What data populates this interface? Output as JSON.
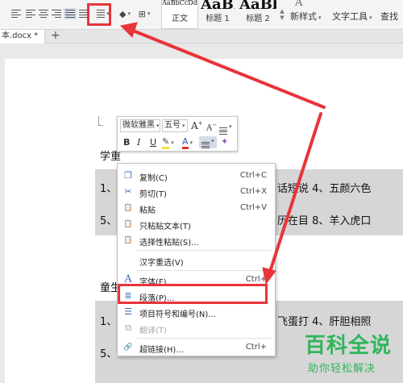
{
  "ribbon": {
    "styles": [
      {
        "preview": "AaBbCcDd",
        "label": "正文"
      },
      {
        "preview": "AaBl",
        "label": "标题 1"
      },
      {
        "preview": "AaBb",
        "label": "标题 2"
      }
    ],
    "new_style_label": "新样式",
    "new_style_icon_letter": "A",
    "text_tools_label": "文字工具",
    "find_label": "查找"
  },
  "tabs": {
    "doc_tab_label": "本.docx *",
    "add_tab": "+"
  },
  "mini_toolbar": {
    "font_name": "微软雅黑",
    "font_size": "五号",
    "grow": "A",
    "shrink": "A",
    "bold": "B",
    "italic": "I",
    "underline": "U",
    "font_color": "A"
  },
  "document": {
    "lines": [
      {
        "text": "学重"
      },
      {
        "text": "1、"
      },
      {
        "text": "话短说   4、五颜六色"
      },
      {
        "text": "5、"
      },
      {
        "text": "历在目   8、羊入虎口"
      },
      {
        "text": "童生"
      },
      {
        "text": "1、"
      },
      {
        "text": "飞蛋打   4、肝胆相照"
      },
      {
        "text": "5、"
      }
    ]
  },
  "context_menu": {
    "items": [
      {
        "label": "复制(C)",
        "shortcut": "Ctrl+C",
        "icon": "copy-icon",
        "glyph": "❐"
      },
      {
        "label": "剪切(T)",
        "shortcut": "Ctrl+X",
        "icon": "cut-icon",
        "glyph": "✂"
      },
      {
        "label": "粘贴",
        "shortcut": "Ctrl+V",
        "icon": "paste-icon",
        "glyph": "📋"
      },
      {
        "label": "只粘贴文本(T)",
        "shortcut": "",
        "icon": "paste-text-icon",
        "glyph": "📋"
      },
      {
        "label": "选择性粘贴(S)...",
        "shortcut": "",
        "icon": "paste-special-icon",
        "glyph": "📋"
      },
      {
        "label": "汉字重选(V)",
        "shortcut": "",
        "icon": "",
        "glyph": ""
      },
      {
        "label": "字体(F)...",
        "shortcut": "Ctrl+",
        "icon": "font-icon",
        "glyph": "A"
      },
      {
        "label": "段落(P)...",
        "shortcut": "",
        "icon": "paragraph-icon",
        "glyph": "≣"
      },
      {
        "label": "项目符号和编号(N)...",
        "shortcut": "",
        "icon": "bullets-icon",
        "glyph": "☰"
      },
      {
        "label": "翻译(T)",
        "shortcut": "",
        "icon": "translate-icon",
        "glyph": "⧉"
      },
      {
        "label": "超链接(H)...",
        "shortcut": "Ctrl+",
        "icon": "hyperlink-icon",
        "glyph": "🔗"
      }
    ]
  },
  "watermark": {
    "title": "百科全说",
    "subtitle": "助你轻松解决"
  },
  "colors": {
    "highlight_box": "#e8343a",
    "watermark": "#2fb65a"
  }
}
